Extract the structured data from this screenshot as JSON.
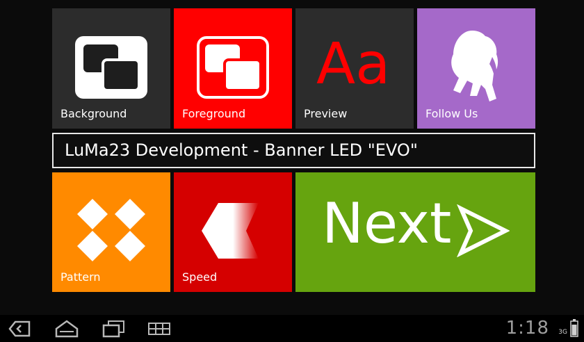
{
  "tiles": {
    "background": {
      "label": "Background"
    },
    "foreground": {
      "label": "Foreground"
    },
    "preview": {
      "label": "Preview",
      "glyph": "Aa"
    },
    "follow": {
      "label": "Follow Us"
    },
    "pattern": {
      "label": "Pattern"
    },
    "speed": {
      "label": "Speed"
    },
    "next": {
      "label": "Next"
    }
  },
  "banner": {
    "text": "LuMa23 Development - Banner LED \"EVO\""
  },
  "statusbar": {
    "time": "1:18",
    "network": "3G"
  },
  "colors": {
    "dark_tile": "#2c2c2c",
    "foreground_tile": "#ff0000",
    "follow_tile": "#a569c9",
    "pattern_tile": "#ff8a00",
    "speed_tile": "#d50000",
    "next_tile": "#66a40f"
  },
  "icons": {
    "background": "overlapping-squares-icon",
    "foreground": "overlapping-squares-icon",
    "follow": "figure-silhouette-icon",
    "pattern": "diamond-pattern-icon",
    "speed": "arrow-left-motion-icon",
    "next": "arrow-right-outline-icon",
    "back": "back-icon",
    "home": "home-icon",
    "recents": "recent-apps-icon",
    "menu": "menu-grid-icon",
    "battery": "battery-icon"
  }
}
